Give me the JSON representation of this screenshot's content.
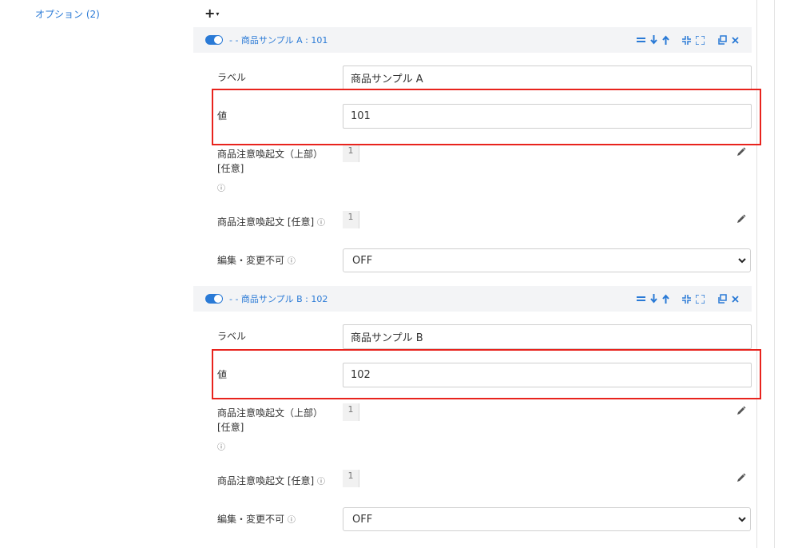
{
  "sidebar": {
    "title": "オプション (2)"
  },
  "toolbar": {
    "add_icon": "plus-icon",
    "caret_icon": "caret-down-icon"
  },
  "items": [
    {
      "title": "- - 商品サンプル A : 101",
      "label_caption": "ラベル",
      "label_value": "商品サンプル A",
      "value_caption": "値",
      "value_value": "101",
      "notice_top_caption_1": "商品注意喚起文（上部）",
      "notice_top_caption_2": "[任意]",
      "notice_top_value": "1",
      "notice_caption": "商品注意喚起文 [任意]",
      "notice_value": "1",
      "lock_caption": "編集・変更不可",
      "lock_value": "OFF"
    },
    {
      "title": "- - 商品サンプル B : 102",
      "label_caption": "ラベル",
      "label_value": "商品サンプル B",
      "value_caption": "値",
      "value_value": "102",
      "notice_top_caption_1": "商品注意喚起文（上部）",
      "notice_top_caption_2": "[任意]",
      "notice_top_value": "1",
      "notice_caption": "商品注意喚起文 [任意]",
      "notice_value": "1",
      "lock_caption": "編集・変更不可",
      "lock_value": "OFF"
    }
  ],
  "icons": {
    "info": "ⓘ",
    "actions": [
      "drag-handle-icon",
      "arrow-down-icon",
      "arrow-up-icon",
      "collapse-icon",
      "expand-icon",
      "copy-icon",
      "close-icon"
    ]
  },
  "colors": {
    "accent": "#2a7ad6",
    "highlight": "#e8231d"
  }
}
